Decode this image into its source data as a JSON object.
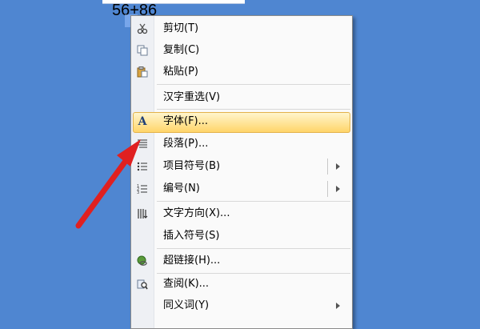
{
  "document": {
    "visible_text": "56+86"
  },
  "menu": {
    "items": [
      {
        "label": "剪切(T)",
        "icon": "scissors-icon"
      },
      {
        "label": "复制(C)",
        "icon": "copy-icon"
      },
      {
        "label": "粘贴(P)",
        "icon": "paste-icon"
      },
      {
        "label": "汉字重选(V)",
        "icon": ""
      },
      {
        "label": "字体(F)...",
        "icon": "font-icon",
        "highlighted": true
      },
      {
        "label": "段落(P)...",
        "icon": "paragraph-icon"
      },
      {
        "label": "项目符号(B)",
        "icon": "bullets-icon",
        "submenu": true
      },
      {
        "label": "编号(N)",
        "icon": "numbering-icon",
        "submenu": true
      },
      {
        "label": "文字方向(X)...",
        "icon": "text-direction-icon"
      },
      {
        "label": "插入符号(S)",
        "icon": ""
      },
      {
        "label": "超链接(H)...",
        "icon": "hyperlink-icon"
      },
      {
        "label": "查阅(K)...",
        "icon": "lookup-icon"
      },
      {
        "label": "同义词(Y)",
        "icon": "",
        "submenu": true
      }
    ]
  },
  "annotation": {
    "arrow_color": "#e02020"
  },
  "colors": {
    "desktop": "#4f86d1",
    "highlight_border": "#e3b24b"
  }
}
